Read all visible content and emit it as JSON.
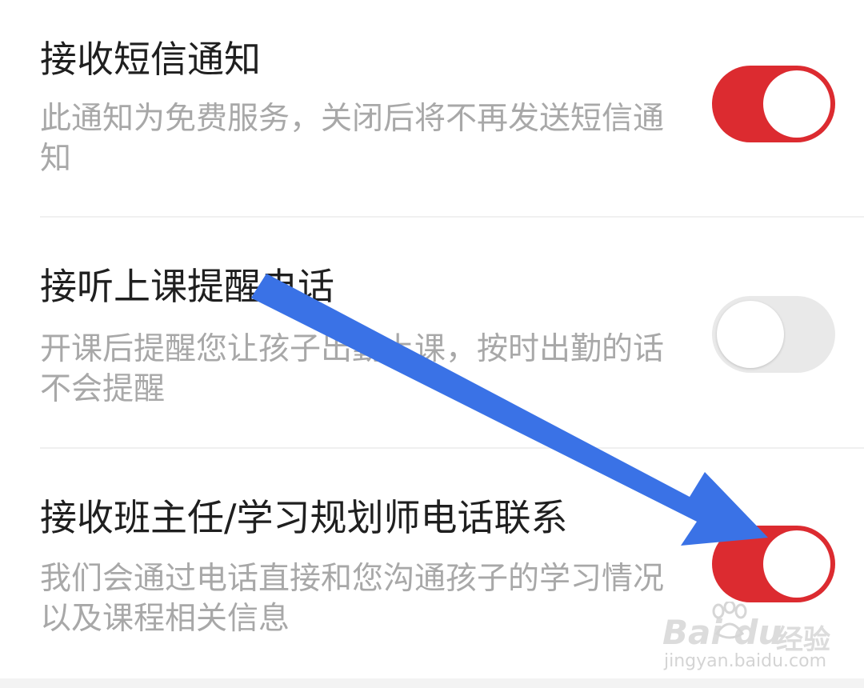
{
  "settings": [
    {
      "title": "接收短信通知",
      "description": "此通知为免费服务，关闭后将不再发送短信通知",
      "enabled": true
    },
    {
      "title": "接听上课提醒电话",
      "description": "开课后提醒您让孩子出勤上课，按时出勤的话不会提醒",
      "enabled": false
    },
    {
      "title": "接收班主任/学习规划师电话联系",
      "description": "我们会通过电话直接和您沟通孩子的学习情况以及课程相关信息",
      "enabled": true
    }
  ],
  "colors": {
    "toggle_on": "#dc2b30",
    "toggle_off": "#e9e9e9",
    "annotation_arrow": "#3a72e6"
  },
  "watermark": {
    "logo": "Bai du",
    "brand": "经验",
    "url": "jingyan.baidu.com"
  }
}
